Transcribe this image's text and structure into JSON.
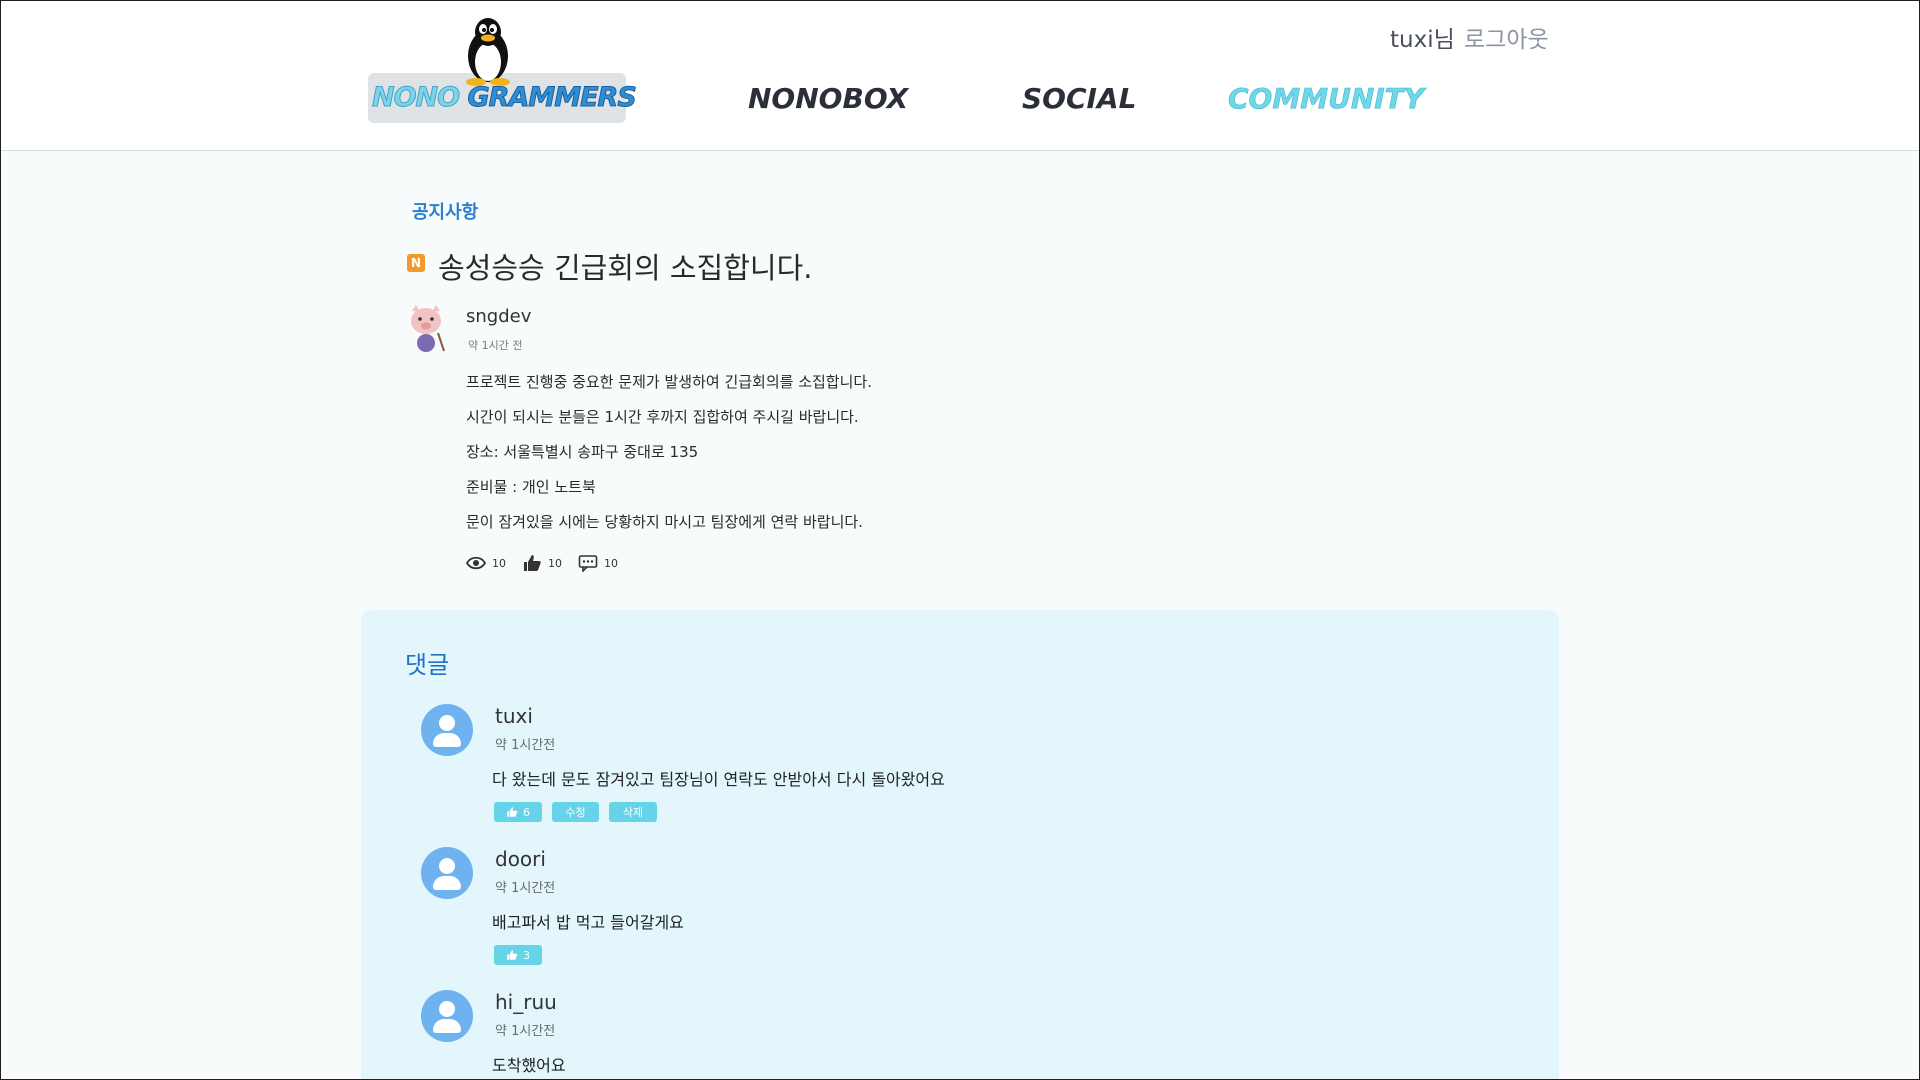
{
  "header": {
    "logo": {
      "text_part1": "NONO",
      "text_part2": "GRAMMERS"
    },
    "nav": [
      {
        "label": "NONOBOX"
      },
      {
        "label": "SOCIAL"
      },
      {
        "label": "COMMUNITY"
      }
    ],
    "user": {
      "name": "tuxi님",
      "logout_label": "로그아웃"
    },
    "colors": {
      "active_nav": "#6fd7e8",
      "nav": "#2b2f3a"
    }
  },
  "post": {
    "category": "공지사항",
    "badge": "N",
    "title": "송성승승 긴급회의 소집합니다.",
    "author": "sngdev",
    "time": "약 1시간 전",
    "body": [
      "프로젝트 진행중 중요한 문제가 발생하여 긴급회의를 소집합니다.",
      "시간이 되시는 분들은 1시간 후까지 집합하여 주시길 바랍니다.",
      "장소: 서울특별시 송파구 중대로 135",
      "준비물 : 개인 노트북",
      "문이 잠겨있을 시에는 당황하지 마시고 팀장에게 연락 바랍니다."
    ],
    "stats": {
      "views": "10",
      "likes": "10",
      "comments": "10"
    }
  },
  "comments": {
    "title": "댓글",
    "items": [
      {
        "name": "tuxi",
        "time": "약 1시간전",
        "text": "다 왔는데 문도 잠겨있고 팀장님이 연락도 안받아서 다시 돌아왔어요",
        "likes": "6",
        "edit_label": "수정",
        "delete_label": "삭제"
      },
      {
        "name": "doori",
        "time": "약 1시간전",
        "text": "배고파서 밥 먹고 들어갈게요",
        "likes": "3"
      },
      {
        "name": "hi_ruu",
        "time": "약 1시간전",
        "text": "도착했어요"
      }
    ]
  },
  "icons": [
    "penguin-icon",
    "eye-icon",
    "thumbs-up-icon",
    "comment-icon",
    "user-icon"
  ]
}
